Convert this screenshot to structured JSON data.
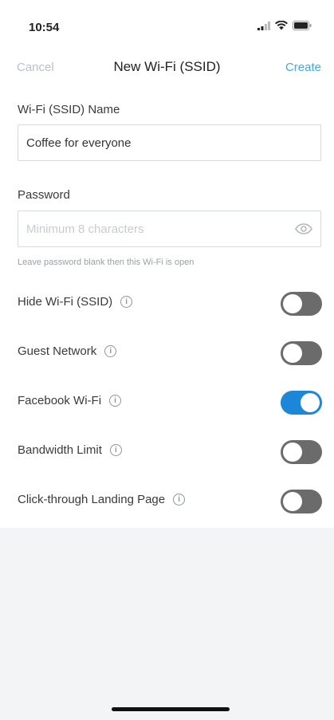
{
  "status_bar": {
    "time": "10:54"
  },
  "nav": {
    "cancel_label": "Cancel",
    "title": "New Wi-Fi (SSID)",
    "create_label": "Create"
  },
  "ssid_name": {
    "label": "Wi-Fi (SSID) Name",
    "value": "Coffee for everyone"
  },
  "password": {
    "label": "Password",
    "placeholder": "Minimum 8 characters",
    "value": "",
    "helper": "Leave password blank then this Wi-Fi is open"
  },
  "toggles": [
    {
      "label": "Hide Wi-Fi (SSID)",
      "on": false
    },
    {
      "label": "Guest Network",
      "on": false
    },
    {
      "label": "Facebook Wi-Fi",
      "on": true
    },
    {
      "label": "Bandwidth Limit",
      "on": false
    },
    {
      "label": "Click-through Landing Page",
      "on": false
    }
  ],
  "colors": {
    "accent": "#4aa8d8",
    "toggle_on": "#1c87d8",
    "toggle_off": "#6b6b6b"
  },
  "icons": {
    "info": "info-icon",
    "eye": "eye-icon"
  }
}
